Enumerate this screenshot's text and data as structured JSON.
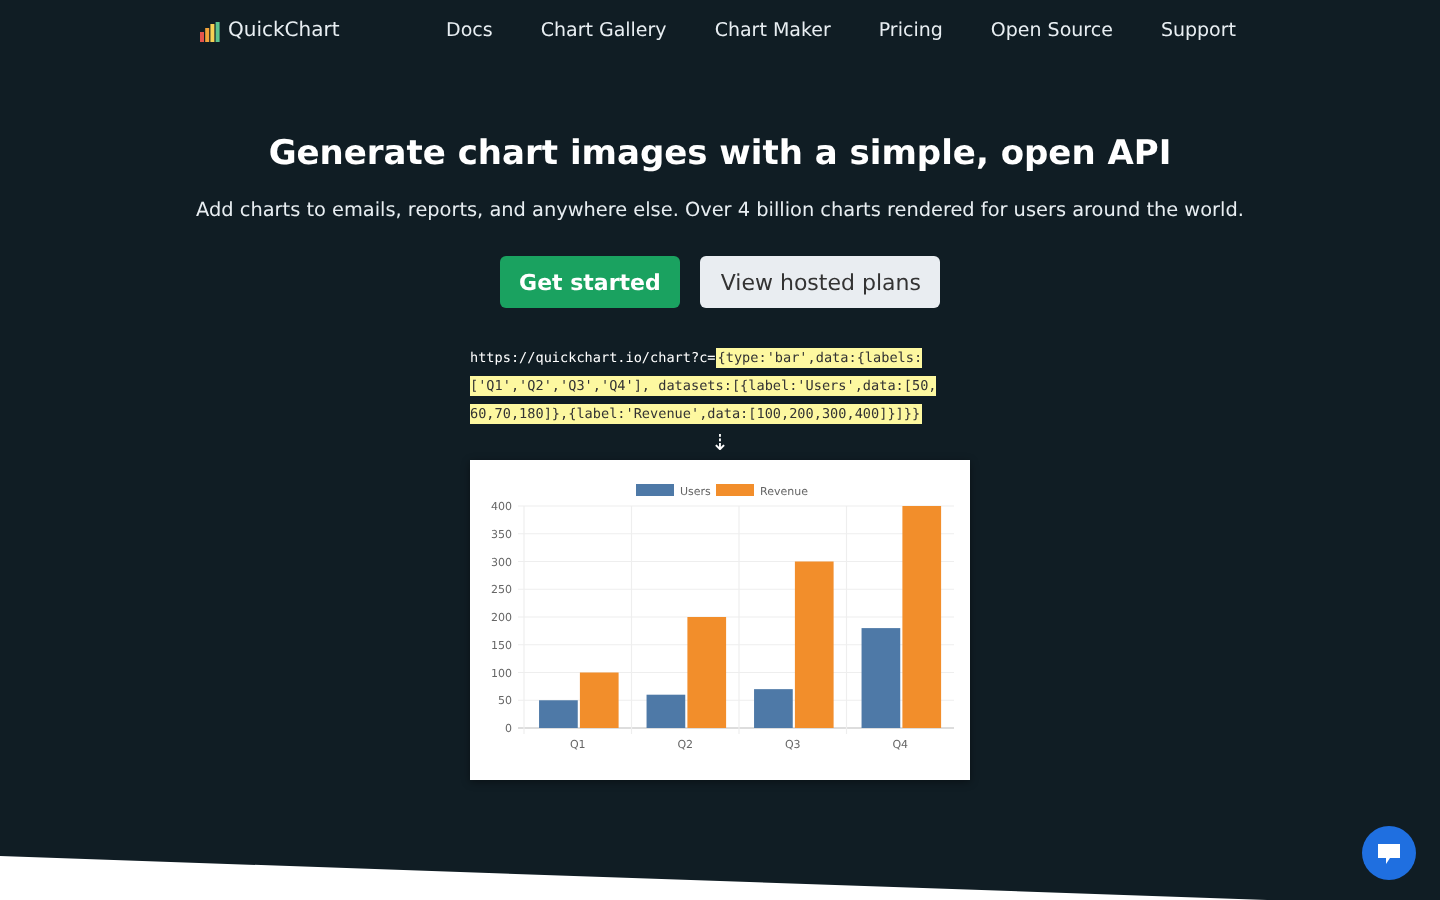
{
  "nav": {
    "brand": "QuickChart",
    "links": [
      "Docs",
      "Chart Gallery",
      "Chart Maker",
      "Pricing",
      "Open Source",
      "Support"
    ]
  },
  "hero": {
    "title": "Generate chart images with a simple, open API",
    "subtitle": "Add charts to emails, reports, and anywhere else. Over 4 billion charts rendered for users around the world.",
    "buttons": [
      {
        "label": "Get started",
        "kind": "primary"
      },
      {
        "label": "View hosted plans",
        "kind": "secondary"
      }
    ],
    "code": {
      "url": "https://quickchart.io/chart?c=",
      "config": "{type:'bar',data:{labels:['Q1','Q2','Q3','Q4'], datasets:[{label:'Users',data:[50,60,70,180]},{label:'Revenue',data:[100,200,300,400]}]}}"
    },
    "arrow": "⇣",
    "chart": {
      "chart_data": {
        "type": "bar",
        "categories": [
          "Q1",
          "Q2",
          "Q3",
          "Q4"
        ],
        "series": [
          {
            "name": "Users",
            "color": "#4e79a7",
            "values": [
              50,
              60,
              70,
              180
            ]
          },
          {
            "name": "Revenue",
            "color": "#f28e2b",
            "values": [
              100,
              200,
              300,
              400
            ]
          }
        ],
        "grid": true,
        "legend": true,
        "ylim": [
          0,
          400
        ],
        "yticks": [
          0,
          50,
          100,
          150,
          200,
          250,
          300,
          350,
          400
        ]
      }
    }
  }
}
